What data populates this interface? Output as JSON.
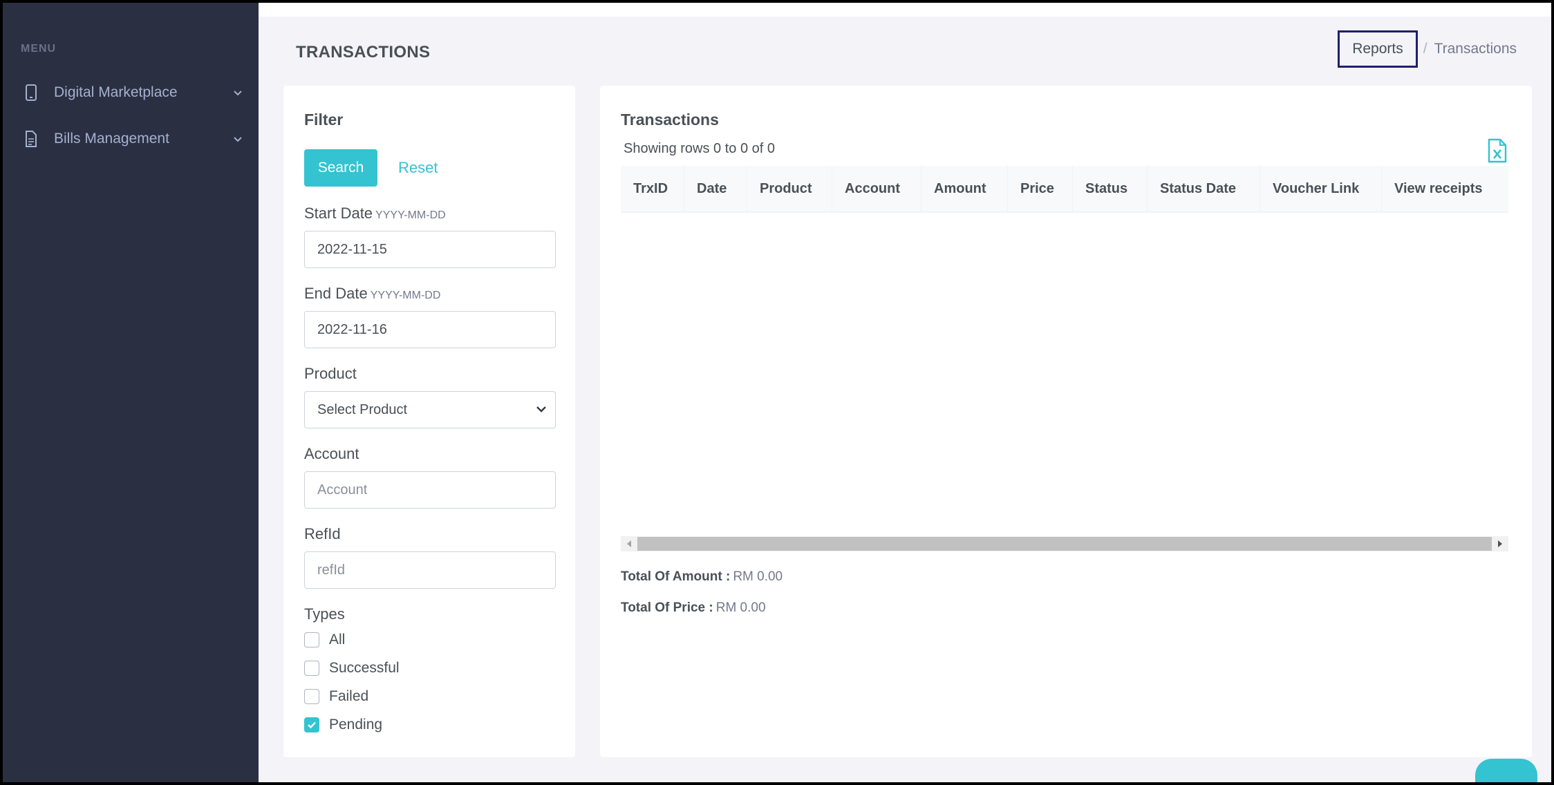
{
  "sidebar": {
    "menu_title": "MENU",
    "items": [
      {
        "label": "Digital Marketplace",
        "icon": "mobile-phone-icon"
      },
      {
        "label": "Bills Management",
        "icon": "document-icon"
      }
    ]
  },
  "header": {
    "title": "TRANSACTIONS",
    "breadcrumb": {
      "link": "Reports",
      "separator": "/",
      "current": "Transactions"
    }
  },
  "filter": {
    "title": "Filter",
    "search_label": "Search",
    "reset_label": "Reset",
    "start_date": {
      "label": "Start Date",
      "hint": "YYYY-MM-DD",
      "value": "2022-11-15"
    },
    "end_date": {
      "label": "End Date",
      "hint": "YYYY-MM-DD",
      "value": "2022-11-16"
    },
    "product": {
      "label": "Product",
      "selected": "Select Product"
    },
    "account": {
      "label": "Account",
      "placeholder": "Account"
    },
    "refid": {
      "label": "RefId",
      "placeholder": "refId"
    },
    "types": {
      "label": "Types",
      "options": [
        {
          "label": "All",
          "checked": false
        },
        {
          "label": "Successful",
          "checked": false
        },
        {
          "label": "Failed",
          "checked": false
        },
        {
          "label": "Pending",
          "checked": true
        }
      ]
    }
  },
  "transactions": {
    "title": "Transactions",
    "showing": "Showing rows 0 to 0 of 0",
    "columns": [
      "TrxID",
      "Date",
      "Product",
      "Account",
      "Amount",
      "Price",
      "Status",
      "Status Date",
      "Voucher Link",
      "View receipts"
    ],
    "rows": [],
    "total_amount": {
      "label": "Total Of Amount :",
      "value": "RM 0.00"
    },
    "total_price": {
      "label": "Total Of Price :",
      "value": "RM 0.00"
    }
  },
  "colors": {
    "sidebar_bg": "#2a3042",
    "accent": "#34c3d0",
    "page_bg": "#f3f3f8",
    "highlight_border": "#20206a"
  }
}
